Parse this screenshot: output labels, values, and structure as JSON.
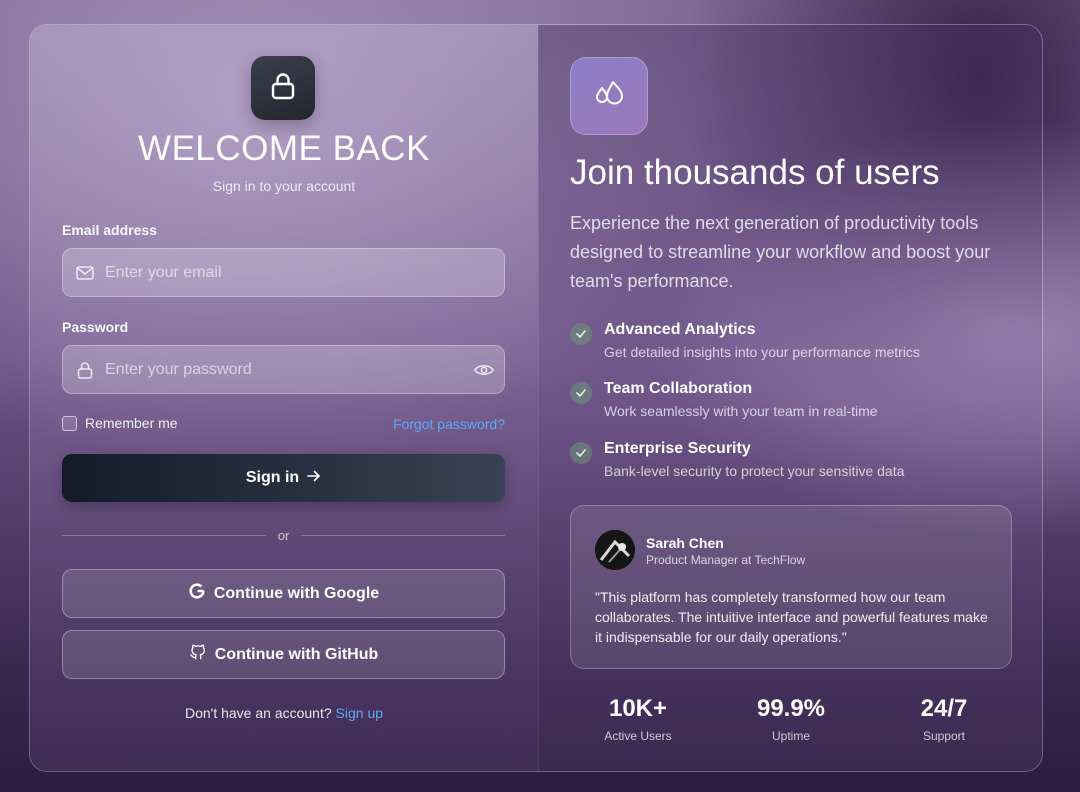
{
  "login": {
    "title": "WELCOME BACK",
    "subtitle": "Sign in to your account",
    "email_label": "Email address",
    "email_placeholder": "Enter your email",
    "password_label": "Password",
    "password_placeholder": "Enter your password",
    "remember_label": "Remember me",
    "forgot_label": "Forgot password?",
    "signin_label": "Sign in",
    "divider_text": "or",
    "google_label": "Continue with Google",
    "github_label": "Continue with GitHub",
    "no_account_text": "Don't have an account?",
    "signup_label": "Sign up"
  },
  "promo": {
    "title": "Join thousands of users",
    "description": "Experience the next generation of productivity tools designed to streamline your workflow and boost your team's performance.",
    "features": [
      {
        "title": "Advanced Analytics",
        "desc": "Get detailed insights into your performance metrics"
      },
      {
        "title": "Team Collaboration",
        "desc": "Work seamlessly with your team in real-time"
      },
      {
        "title": "Enterprise Security",
        "desc": "Bank-level security to protect your sensitive data"
      }
    ],
    "testimonial": {
      "name": "Sarah Chen",
      "role": "Product Manager at TechFlow",
      "quote": "\"This platform has completely transformed how our team collaborates. The intuitive interface and powerful features make it indispensable for our daily operations.\""
    },
    "stats": [
      {
        "value": "10K+",
        "label": "Active Users"
      },
      {
        "value": "99.9%",
        "label": "Uptime"
      },
      {
        "value": "24/7",
        "label": "Support"
      }
    ]
  },
  "colors": {
    "link": "#5ea8f5",
    "signin_button": "#1e2533",
    "brand_badge": "#8b7fc8",
    "check": "#6e9678"
  },
  "icons": [
    "lock-icon",
    "drops-icon",
    "mail-icon",
    "lock-small-icon",
    "eye-icon",
    "arrow-right-icon",
    "google-icon",
    "github-icon",
    "check-icon"
  ]
}
